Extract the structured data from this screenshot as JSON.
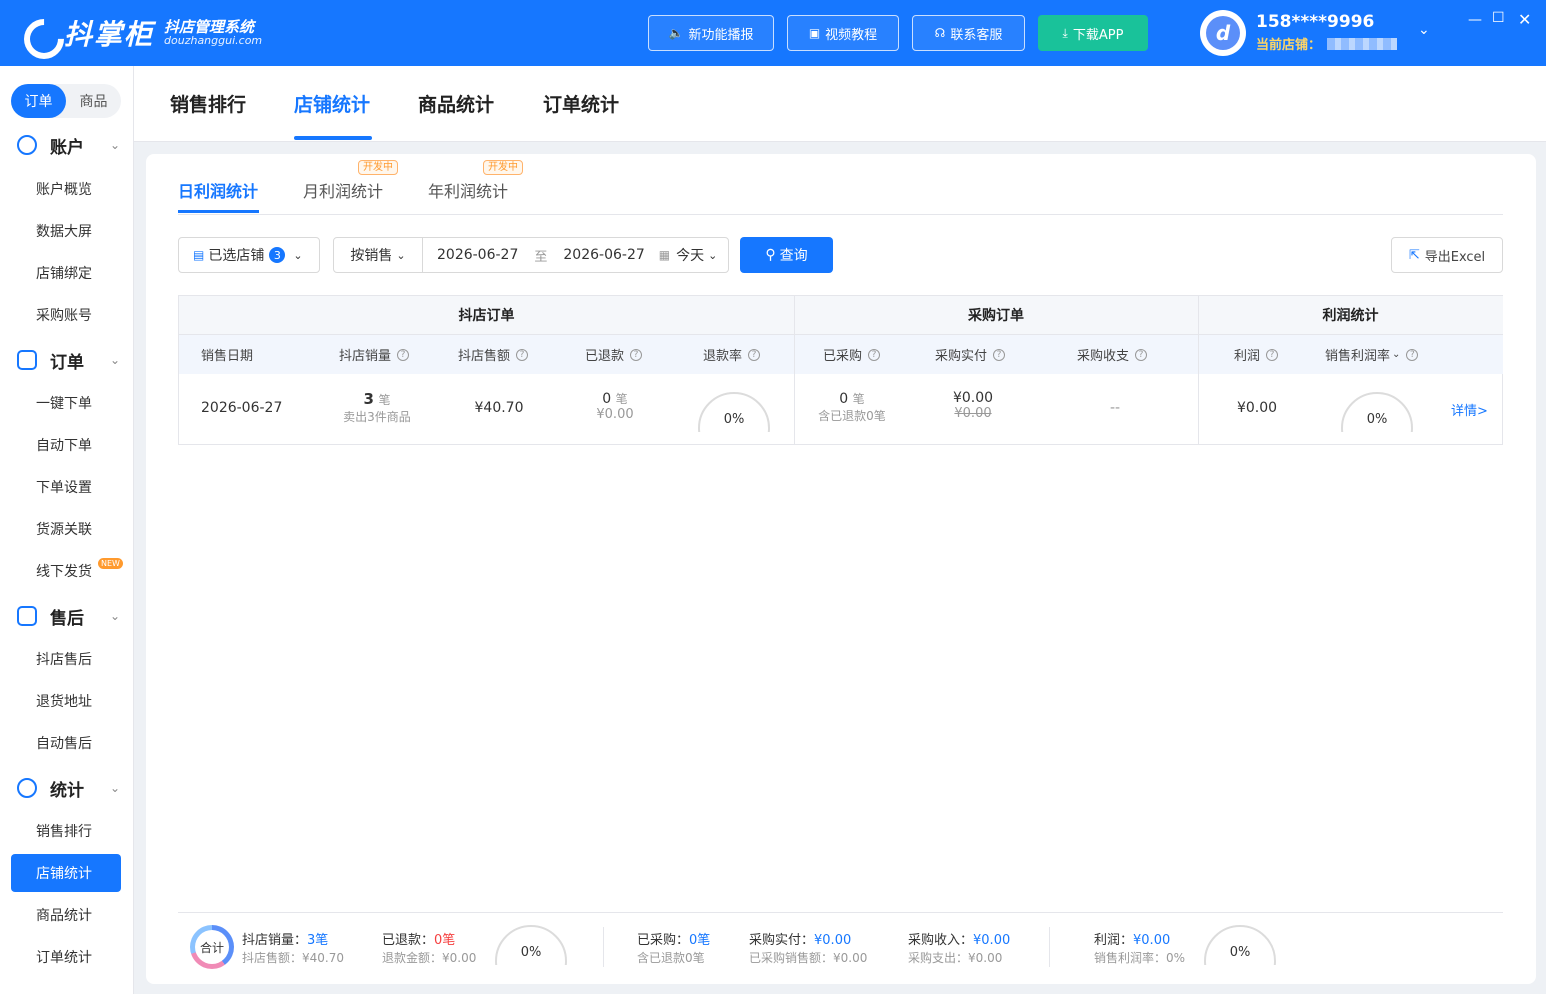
{
  "app": {
    "logo_text": "抖掌柜",
    "logo_sub": "抖店管理系统",
    "logo_domain": "douzhanggui.com"
  },
  "toolbar": {
    "new_features": "新功能播报",
    "video_tutorial": "视频教程",
    "contact_service": "联系客服",
    "download_app": "下载APP"
  },
  "user": {
    "phone": "158****9996",
    "store_label": "当前店铺："
  },
  "sidebar": {
    "toggle": [
      "订单",
      "商品"
    ],
    "groups": [
      {
        "label": "账户",
        "items": [
          "账户概览",
          "数据大屏",
          "店铺绑定",
          "采购账号"
        ]
      },
      {
        "label": "订单",
        "items": [
          "一键下单",
          "自动下单",
          "下单设置",
          "货源关联",
          "线下发货"
        ]
      },
      {
        "label": "售后",
        "items": [
          "抖店售后",
          "退货地址",
          "自动售后"
        ]
      },
      {
        "label": "统计",
        "items": [
          "销售排行",
          "店铺统计",
          "商品统计",
          "订单统计"
        ]
      }
    ],
    "new_badge": "NEW",
    "active": "店铺统计"
  },
  "top_tabs": [
    "销售排行",
    "店铺统计",
    "商品统计",
    "订单统计"
  ],
  "sub_tabs": [
    "日利润统计",
    "月利润统计",
    "年利润统计"
  ],
  "dev_tag": "开发中",
  "filters": {
    "store_label": "已选店铺",
    "store_count": "3",
    "mode": "按销售",
    "date_from": "2026-06-27",
    "to": "至",
    "date_to": "2026-06-27",
    "quick": "今天",
    "query": "查询",
    "export": "导出Excel"
  },
  "table": {
    "groups": [
      "抖店订单",
      "采购订单",
      "利润统计"
    ],
    "columns": [
      "销售日期",
      "抖店销量",
      "抖店售额",
      "已退款",
      "退款率",
      "已采购",
      "采购实付",
      "采购收支",
      "利润",
      "销售利润率"
    ],
    "row": {
      "date": "2026-06-27",
      "sales_count": "3",
      "unit": "笔",
      "sold_items": "卖出3件商品",
      "sales_amount": "¥40.70",
      "refund_count": "0",
      "refund_amount": "¥0.00",
      "refund_rate": "0%",
      "purchased": "0",
      "purchased_refund": "含已退款0笔",
      "purchase_paid": "¥0.00",
      "purchase_paid_strike": "¥0.00",
      "purchase_balance": "--",
      "profit": "¥0.00",
      "profit_rate": "0%",
      "detail": "详情>"
    }
  },
  "footer": {
    "total": "合计",
    "sales_count_label": "抖店销量：",
    "sales_count": "3笔",
    "sales_amount_label": "抖店售额：",
    "sales_amount": "¥40.70",
    "refunded_label": "已退款：",
    "refunded": "0笔",
    "refund_amount_label": "退款金额：",
    "refund_amount": "¥0.00",
    "refund_rate": "0%",
    "purchased_label": "已采购：",
    "purchased": "0笔",
    "purchased_refund": "含已退款0笔",
    "purchase_paid_label": "采购实付：",
    "purchase_paid": "¥0.00",
    "purchase_sale_label": "已采购销售额：",
    "purchase_sale": "¥0.00",
    "purchase_income_label": "采购收入：",
    "purchase_income": "¥0.00",
    "purchase_expense_label": "采购支出：",
    "purchase_expense": "¥0.00",
    "profit_label": "利润：",
    "profit": "¥0.00",
    "profit_rate_label": "销售利润率：",
    "profit_rate_val": "0%",
    "profit_rate": "0%"
  }
}
